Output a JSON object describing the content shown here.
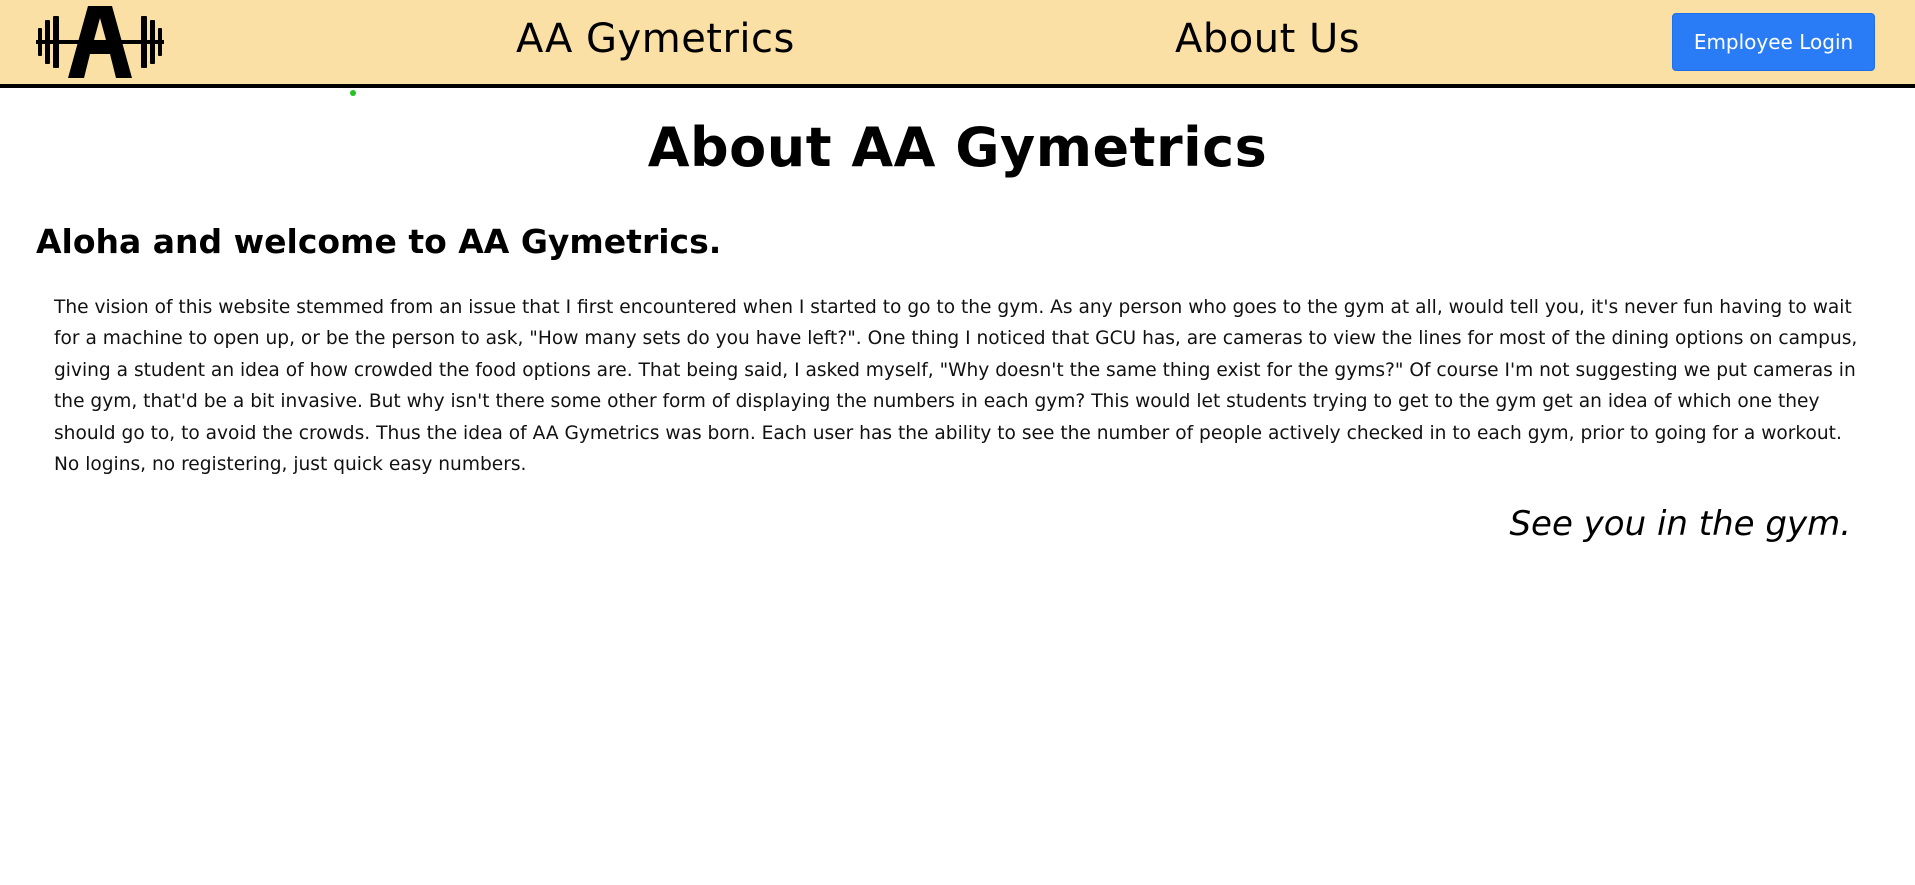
{
  "navbar": {
    "logo_icon": "dumbbell-a-logo-icon",
    "home_label": "AA Gymetrics",
    "about_label": "About Us",
    "login_label": "Employee Login",
    "background_color": "#fae0a4",
    "login_color": "#2a7cf6"
  },
  "main": {
    "title": "About AA Gymetrics",
    "welcome": "Aloha and welcome to AA Gymetrics.",
    "body": "The vision of this website stemmed from an issue that I first encountered when I started to go to the gym. As any person who goes to the gym at all, would tell you, it's never fun having to wait for a machine to open up, or be the person to ask, \"How many sets do you have left?\". One thing I noticed that GCU has, are cameras to view the lines for most of the dining options on campus, giving a student an idea of how crowded the food options are. That being said, I asked myself, \"Why doesn't the same thing exist for the gyms?\" Of course I'm not suggesting we put cameras in the gym, that'd be a bit invasive. But why isn't there some other form of displaying the numbers in each gym? This would let students trying to get to the gym get an idea of which one they should go to, to avoid the crowds. Thus the idea of AA Gymetrics was born. Each user has the ability to see the number of people actively checked in to each gym, prior to going for a workout. No logins, no registering, just quick easy numbers.",
    "signoff": "See you in the gym."
  }
}
